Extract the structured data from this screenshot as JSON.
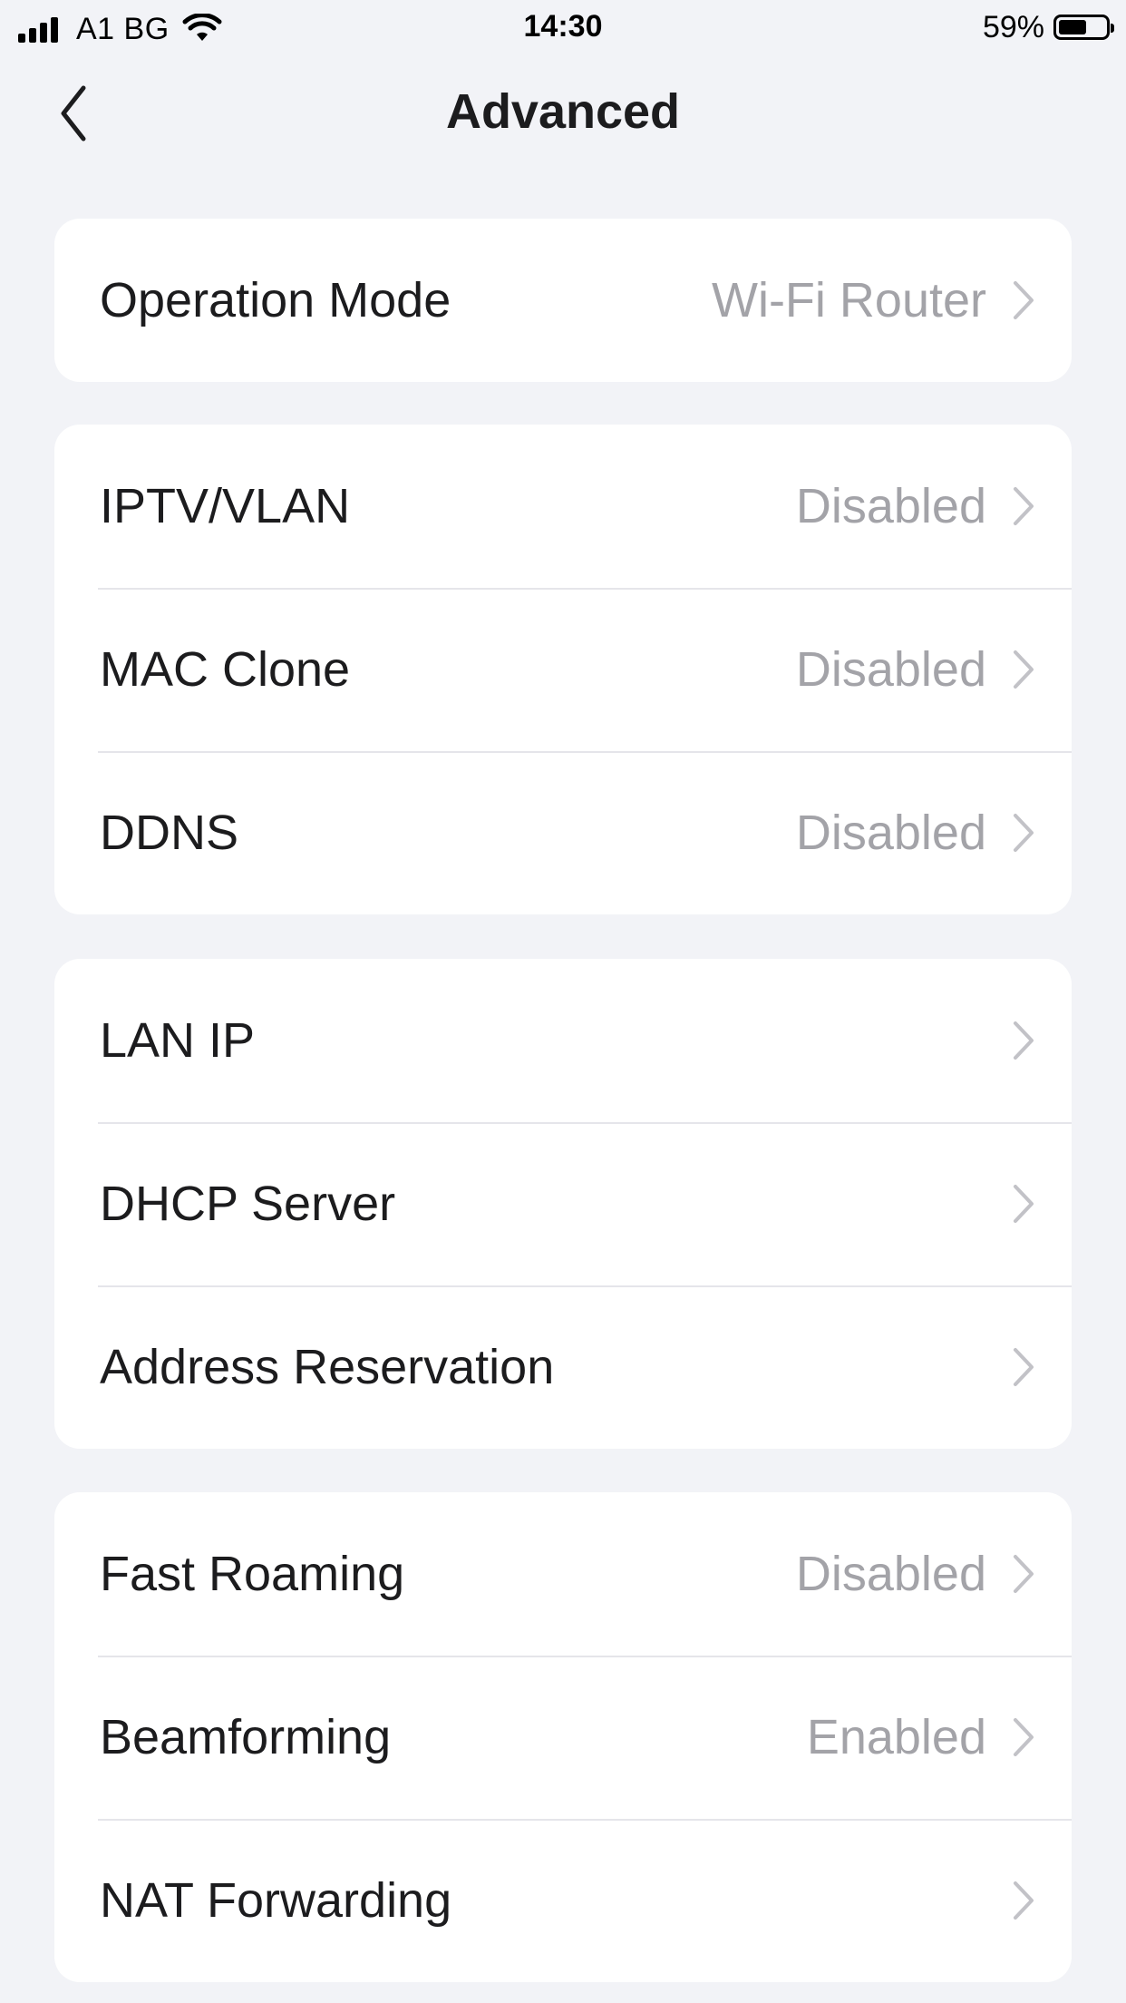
{
  "status_bar": {
    "carrier": "A1 BG",
    "time": "14:30",
    "battery_percent": "59%",
    "battery_level": 0.59
  },
  "header": {
    "title": "Advanced"
  },
  "groups": [
    {
      "rows": [
        {
          "label": "Operation Mode",
          "value": "Wi-Fi Router"
        }
      ]
    },
    {
      "rows": [
        {
          "label": "IPTV/VLAN",
          "value": "Disabled"
        },
        {
          "label": "MAC Clone",
          "value": "Disabled"
        },
        {
          "label": "DDNS",
          "value": "Disabled"
        }
      ]
    },
    {
      "rows": [
        {
          "label": "LAN IP",
          "value": ""
        },
        {
          "label": "DHCP Server",
          "value": ""
        },
        {
          "label": "Address Reservation",
          "value": ""
        }
      ]
    },
    {
      "rows": [
        {
          "label": "Fast Roaming",
          "value": "Disabled"
        },
        {
          "label": "Beamforming",
          "value": "Enabled"
        },
        {
          "label": "NAT Forwarding",
          "value": ""
        }
      ]
    }
  ],
  "colors": {
    "background": "#f2f3f7",
    "card": "#ffffff",
    "label": "#1c1c1e",
    "secondary": "#a3a3a8",
    "separator": "#e5e5ea"
  },
  "icons": {
    "back": "chevron-left-icon",
    "row_arrow": "chevron-right-icon",
    "signal": "cellular-signal-icon",
    "wifi": "wifi-icon",
    "battery": "battery-icon"
  }
}
